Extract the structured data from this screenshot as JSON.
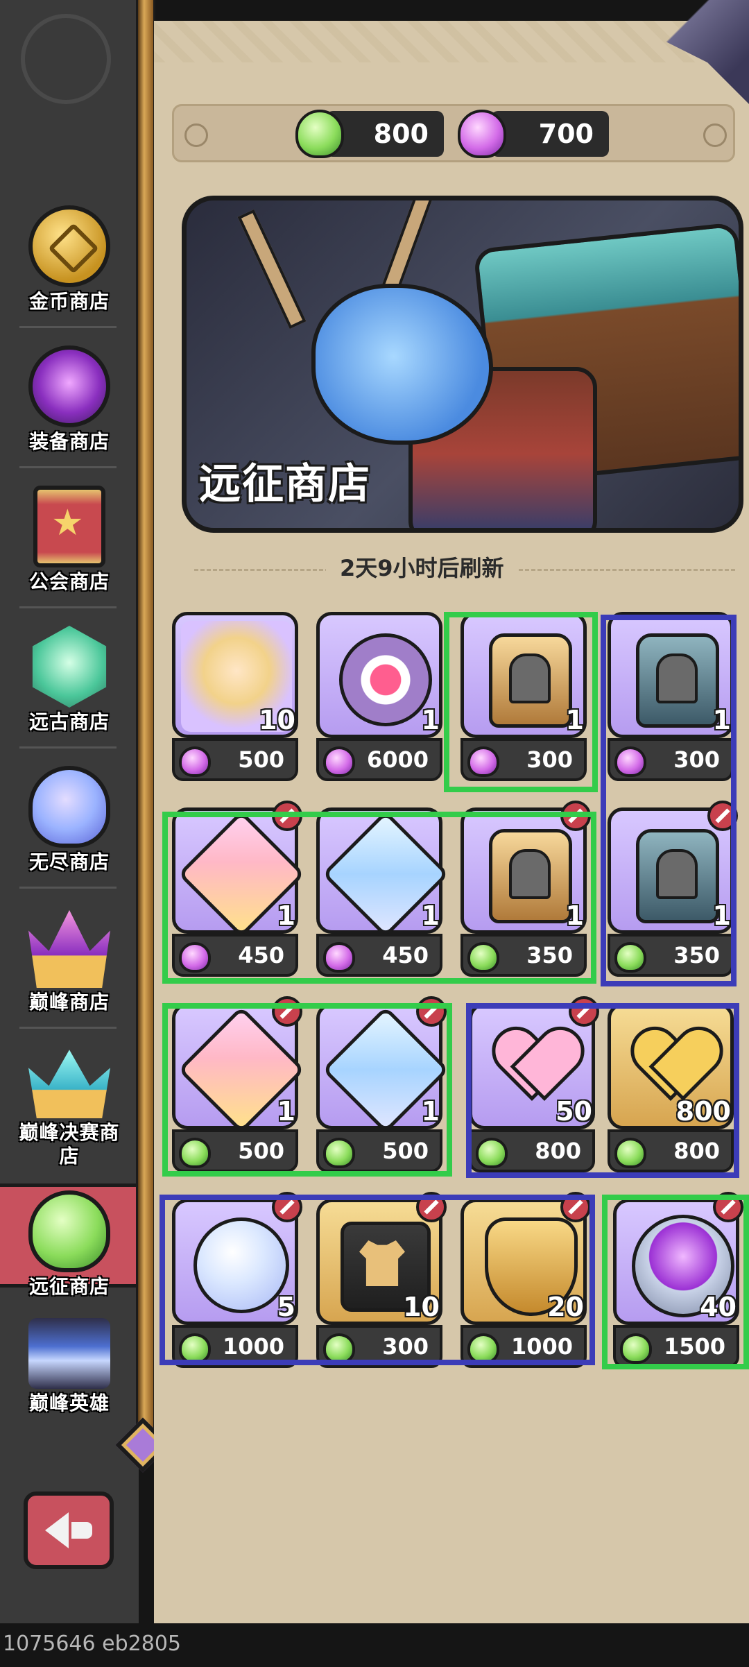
{
  "sidebar": {
    "items": [
      {
        "label": "金币商店",
        "icon": "gold-coin-icon"
      },
      {
        "label": "装备商店",
        "icon": "purple-gear-icon"
      },
      {
        "label": "公会商店",
        "icon": "guild-banner-icon"
      },
      {
        "label": "远古商店",
        "icon": "green-gem-icon"
      },
      {
        "label": "无尽商店",
        "icon": "blue-slime-icon"
      },
      {
        "label": "巅峰商店",
        "icon": "purple-crown-icon"
      },
      {
        "label": "巅峰决赛商店",
        "icon": "cyan-crown-icon"
      },
      {
        "label": "远征商店",
        "icon": "green-slime-icon",
        "active": true
      },
      {
        "label": "巅峰英雄",
        "icon": "hero-portrait-icon"
      }
    ],
    "back_icon": "back-arrow-icon"
  },
  "currency": {
    "green": {
      "value": "800",
      "icon": "green-slime-currency-icon"
    },
    "purple": {
      "value": "700",
      "icon": "purple-slime-currency-icon"
    }
  },
  "banner": {
    "title": "远征商店"
  },
  "refresh_text": "2天9小时后刷新",
  "items": [
    {
      "qty": "10",
      "price": "500",
      "currency": "purple",
      "art": "hero-portrait"
    },
    {
      "qty": "1",
      "price": "6000",
      "currency": "purple",
      "art": "relic"
    },
    {
      "qty": "1",
      "price": "300",
      "currency": "purple",
      "art": "gold-helmet-book"
    },
    {
      "qty": "1",
      "price": "300",
      "currency": "purple",
      "art": "steel-helmet-book"
    },
    {
      "qty": "1",
      "price": "450",
      "currency": "purple",
      "art": "pink-crystal",
      "sold": true
    },
    {
      "qty": "1",
      "price": "450",
      "currency": "purple",
      "art": "blue-crystal"
    },
    {
      "qty": "1",
      "price": "350",
      "currency": "green",
      "art": "gold-helmet-book",
      "sold": true
    },
    {
      "qty": "1",
      "price": "350",
      "currency": "green",
      "art": "steel-helmet-book",
      "sold": true
    },
    {
      "qty": "1",
      "price": "500",
      "currency": "green",
      "art": "pink-crystal",
      "sold": true
    },
    {
      "qty": "1",
      "price": "500",
      "currency": "green",
      "art": "blue-crystal",
      "sold": true
    },
    {
      "qty": "50",
      "price": "800",
      "currency": "green",
      "art": "pink-heart",
      "sold": true
    },
    {
      "qty": "800",
      "price": "800",
      "currency": "green",
      "art": "gold-heart"
    },
    {
      "qty": "5",
      "price": "1000",
      "currency": "green",
      "art": "star-orb",
      "sold": true
    },
    {
      "qty": "10",
      "price": "300",
      "currency": "green",
      "art": "shirt-card",
      "sold": true
    },
    {
      "qty": "20",
      "price": "1000",
      "currency": "green",
      "art": "gold-shield",
      "sold": true
    },
    {
      "qty": "40",
      "price": "1500",
      "currency": "green",
      "art": "purple-orb",
      "sold": true
    }
  ],
  "footer": "1075646 eb2805",
  "colors": {
    "highlight_green": "#33cc4a",
    "highlight_blue": "#3c3cb8",
    "active_tab": "#c8515e"
  }
}
